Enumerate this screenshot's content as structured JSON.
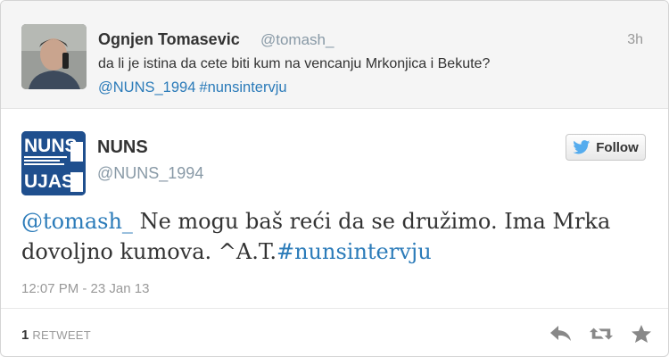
{
  "parent_tweet": {
    "name": "Ognjen Tomasevic",
    "handle": "@tomash_",
    "time": "3h",
    "text": "da li je istina da cete biti kum na vencanju Mrkonjica i Bekute?",
    "tags": [
      "@NUNS_1994",
      "#nunsintervju"
    ]
  },
  "main_tweet": {
    "name": "NUNS",
    "handle": "@NUNS_1994",
    "follow_label": "Follow",
    "mention": "@tomash_",
    "text_body": " Ne mogu baš reći da se družimo. Ima Mrka dovoljno kumova. ^A.T.",
    "hashtag": "#nunsintervju",
    "date": "12:07 PM - 23 Jan 13",
    "retweet_count": "1",
    "retweet_label": "RETWEET",
    "avatar_text": [
      "NUNS",
      "UJAS"
    ]
  },
  "actions": [
    "reply-icon",
    "retweet-icon",
    "favorite-icon"
  ],
  "colors": {
    "link": "#2b7bb9",
    "handle": "#8899a6",
    "muted": "#999999",
    "icon": "#888888"
  }
}
